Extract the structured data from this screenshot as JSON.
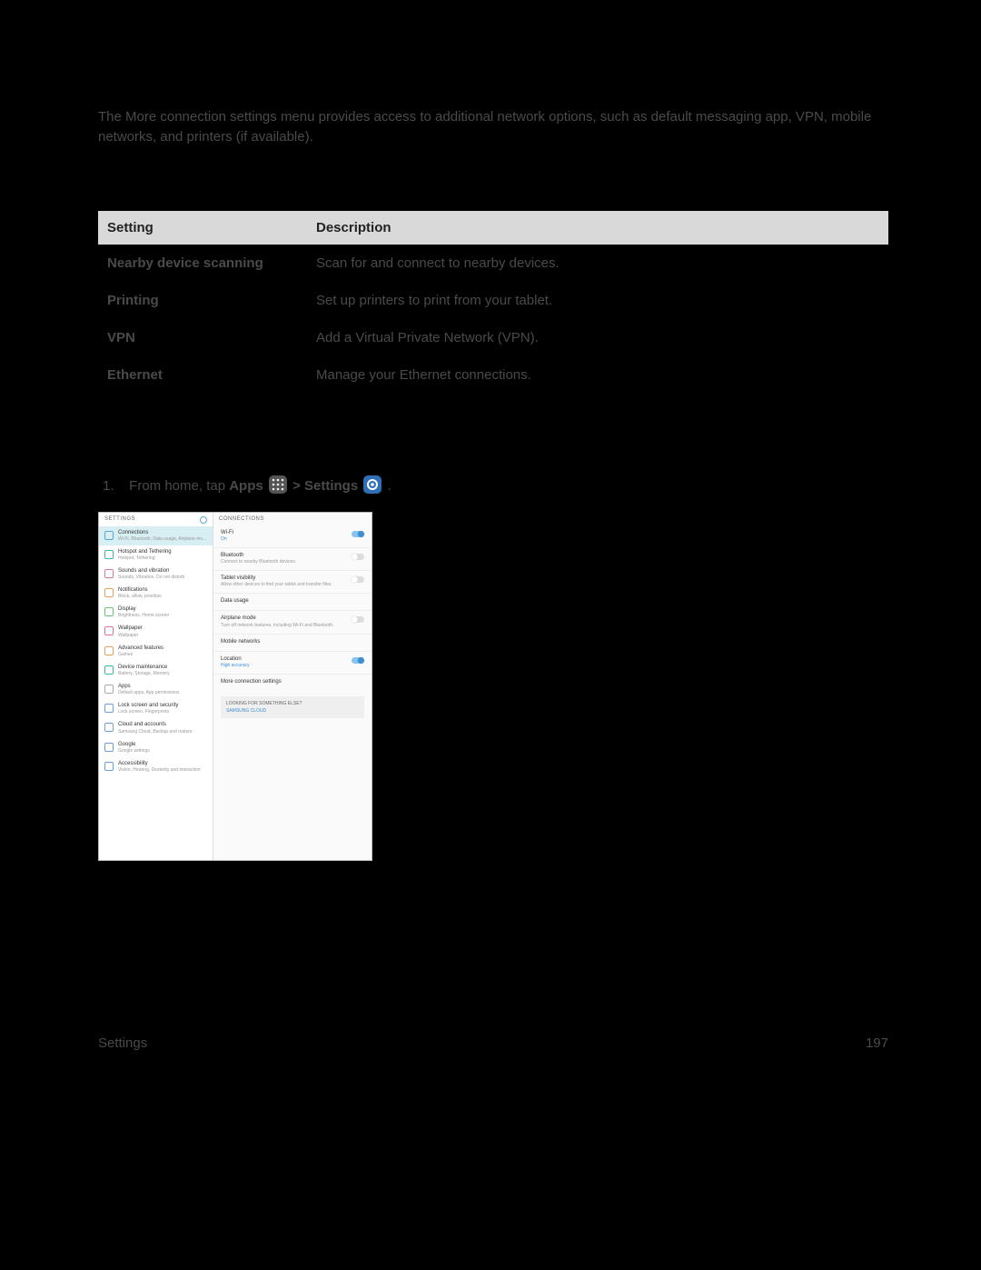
{
  "intro": "The More connection settings menu provides access to additional network options, such as default messaging app, VPN, mobile networks, and printers (if available).",
  "table": {
    "header_setting": "Setting",
    "header_description": "Description",
    "rows": [
      {
        "setting": "Nearby device scanning",
        "desc": "Scan for and connect to nearby devices."
      },
      {
        "setting": "Printing",
        "desc": "Set up printers to print from your tablet."
      },
      {
        "setting": "VPN",
        "desc": "Add a Virtual Private Network (VPN)."
      },
      {
        "setting": "Ethernet",
        "desc": "Manage your Ethernet connections."
      }
    ]
  },
  "step": {
    "number": "1.",
    "pre": "From home, tap ",
    "apps": "Apps",
    "sep": " > ",
    "settings": "Settings",
    "end": "."
  },
  "shot": {
    "left_header": "SETTINGS",
    "right_header": "CONNECTIONS",
    "left": [
      {
        "t": "Connections",
        "s": "Wi-Fi, Bluetooth, Data usage, Airplane mo...",
        "sel": true,
        "ic": "wifi"
      },
      {
        "t": "Hotspot and Tethering",
        "s": "Hotspot, Tethering",
        "ic": "teal"
      },
      {
        "t": "Sounds and vibration",
        "s": "Sounds, Vibration, Do not disturb",
        "ic": "pink"
      },
      {
        "t": "Notifications",
        "s": "Block, allow, prioritize",
        "ic": "orange"
      },
      {
        "t": "Display",
        "s": "Brightness, Home screen",
        "ic": "green"
      },
      {
        "t": "Wallpaper",
        "s": "Wallpaper",
        "ic": "pink"
      },
      {
        "t": "Advanced features",
        "s": "Games",
        "ic": "orange"
      },
      {
        "t": "Device maintenance",
        "s": "Battery, Storage, Memory",
        "ic": "teal"
      },
      {
        "t": "Apps",
        "s": "Default apps, App permissions",
        "ic": "gray"
      },
      {
        "t": "Lock screen and security",
        "s": "Lock screen, Fingerprints",
        "ic": "blue"
      },
      {
        "t": "Cloud and accounts",
        "s": "Samsung Cloud, Backup and restore",
        "ic": "blue"
      },
      {
        "t": "Google",
        "s": "Google settings",
        "ic": "blue"
      },
      {
        "t": "Accessibility",
        "s": "Vision, Hearing, Dexterity and interaction",
        "ic": "blue"
      }
    ],
    "right": [
      {
        "t": "Wi-Fi",
        "sub_on": "On",
        "toggle": "on"
      },
      {
        "t": "Bluetooth",
        "s": "Connect to nearby Bluetooth devices.",
        "toggle": "off"
      },
      {
        "t": "Tablet visibility",
        "s": "Allow other devices to find your tablet and transfer files.",
        "toggle": "off"
      },
      {
        "t": "Data usage"
      },
      {
        "t": "Airplane mode",
        "s": "Turn off network features, including Wi-Fi and Bluetooth.",
        "toggle": "off"
      },
      {
        "t": "Mobile networks"
      },
      {
        "t": "Location",
        "sub_on": "High accuracy",
        "toggle": "on"
      },
      {
        "t": "More connection settings"
      }
    ],
    "promo_t": "LOOKING FOR SOMETHING ELSE?",
    "promo_c": "SAMSUNG CLOUD"
  },
  "footer": {
    "left": "Settings",
    "right": "197"
  }
}
